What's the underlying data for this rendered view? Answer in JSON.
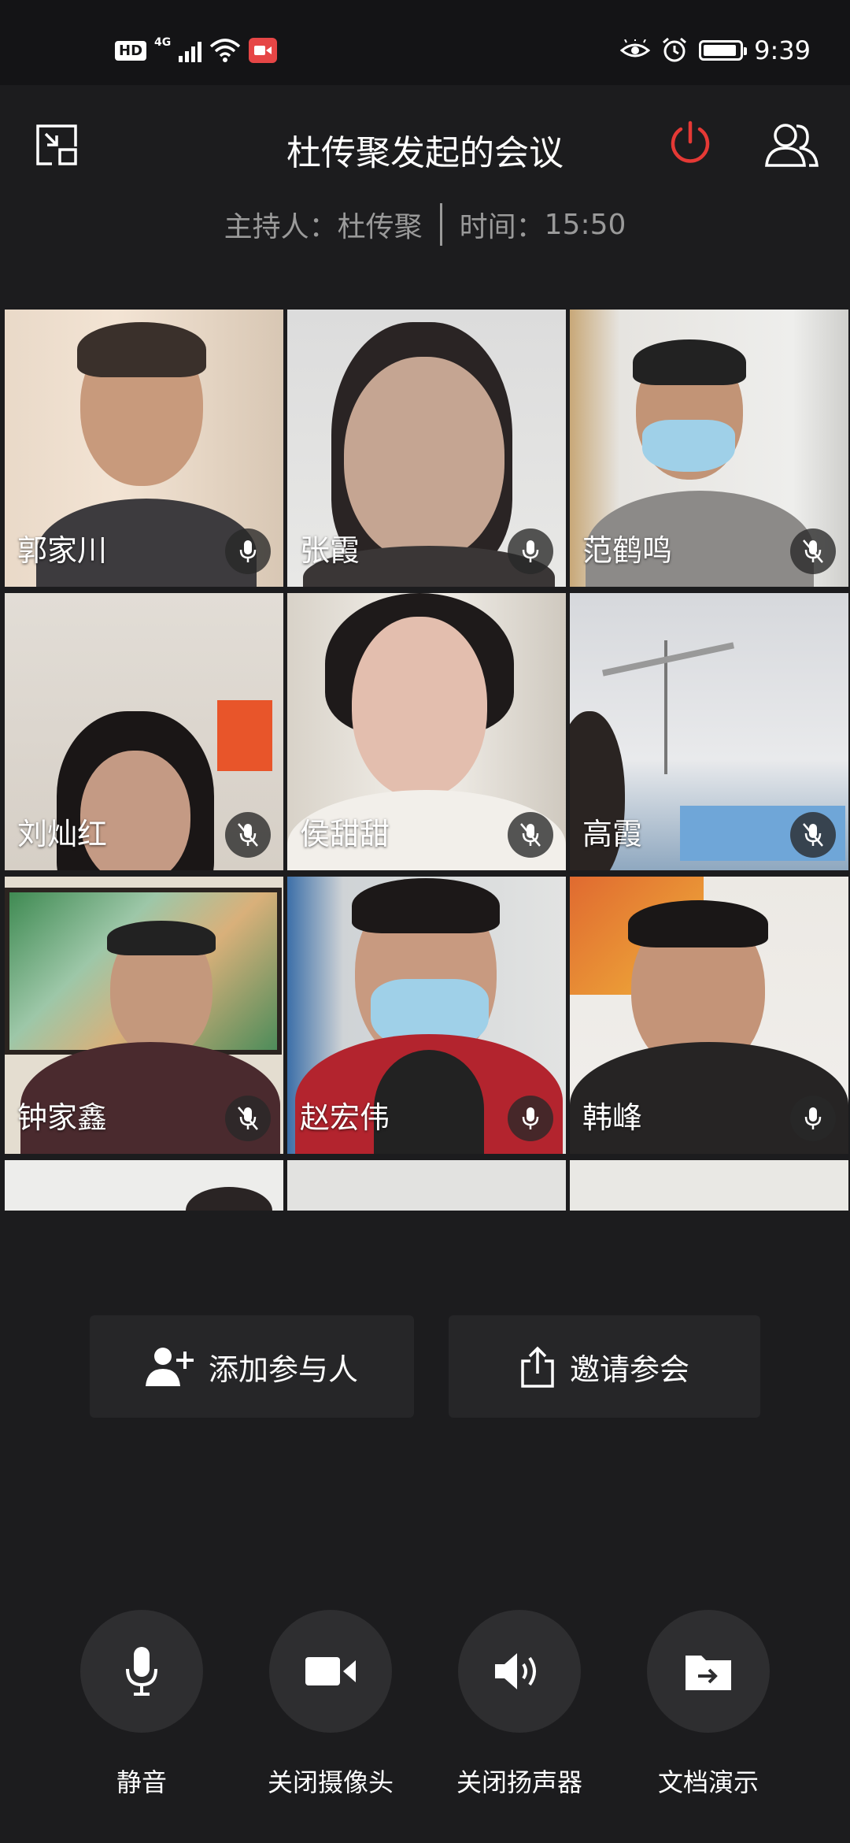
{
  "status_bar": {
    "hd": "HD",
    "network": "4G",
    "time": "9:39"
  },
  "header": {
    "title": "杜传聚发起的会议",
    "host_label": "主持人：",
    "host_name": "杜传聚",
    "time_label": "时间：",
    "time_value": "15:50"
  },
  "participants": [
    {
      "name": "郭家川"
    },
    {
      "name": "张霞"
    },
    {
      "name": "范鹤鸣"
    },
    {
      "name": "刘灿红"
    },
    {
      "name": "侯甜甜"
    },
    {
      "name": "高霞"
    },
    {
      "name": "钟家鑫"
    },
    {
      "name": "赵宏伟"
    },
    {
      "name": "韩峰"
    }
  ],
  "actions": {
    "add_participant": "添加参与人",
    "invite": "邀请参会"
  },
  "controls": {
    "mute": "静音",
    "camera_off": "关闭摄像头",
    "speaker_off": "关闭扬声器",
    "doc_present": "文档演示"
  },
  "colors": {
    "background": "#1c1c1e",
    "status_bar": "#141416",
    "power_red": "#e53935",
    "button_bg": "#262628",
    "control_bg": "#2e2e30",
    "muted_text": "#9a9a9a"
  }
}
